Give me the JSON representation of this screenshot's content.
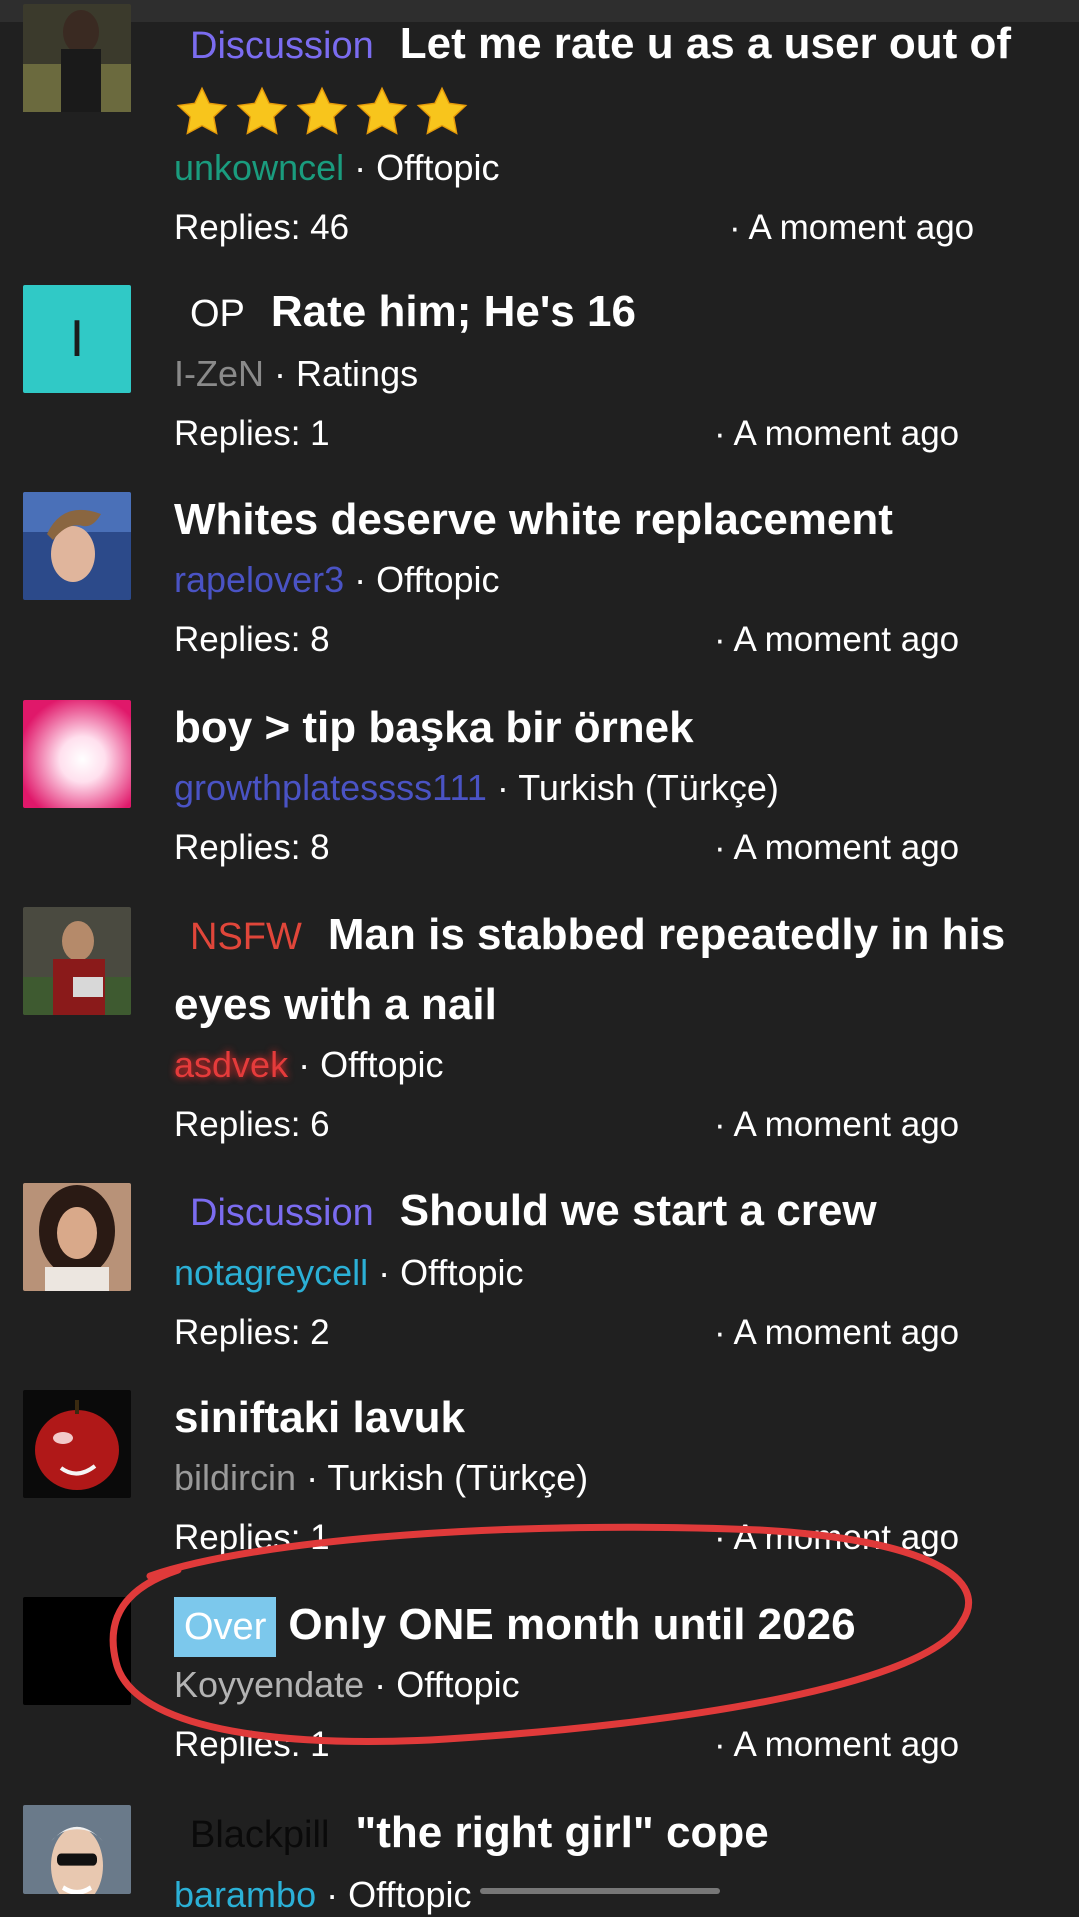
{
  "threads": [
    {
      "tag": "Discussion",
      "title": "Let me rate u as a user out of",
      "rating_stars": 5,
      "author": "unkowncel",
      "category": "Offtopic",
      "replies": "Replies: 46",
      "time": "· A moment ago"
    },
    {
      "avatar_letter": "I",
      "tag": "OP",
      "title": "Rate him; He's 16",
      "author": "I-ZeN",
      "category": "Ratings",
      "replies": "Replies: 1",
      "time": "· A moment ago"
    },
    {
      "title": "Whites deserve white replacement",
      "author": "rapelover3",
      "category": "Offtopic",
      "replies": "Replies: 8",
      "time": "· A moment ago"
    },
    {
      "title": "boy > tip başka bir örnek",
      "author": "growthplatessss111",
      "category": "Turkish (Türkçe)",
      "replies": "Replies: 8",
      "time": "· A moment ago"
    },
    {
      "tag": "NSFW",
      "title": "Man is stabbed repeatedly in his eyes with a nail",
      "author": "asdvek",
      "category": "Offtopic",
      "replies": "Replies: 6",
      "time": "· A moment ago"
    },
    {
      "tag": "Discussion",
      "title": "Should we start a crew",
      "author": "notagreycell",
      "category": "Offtopic",
      "replies": "Replies: 2",
      "time": "· A moment ago"
    },
    {
      "title": "siniftaki lavuk",
      "author": "bildircin",
      "category": "Turkish (Türkçe)",
      "replies": "Replies: 1",
      "time": "· A moment ago"
    },
    {
      "tag": "Over",
      "title": "Only ONE month until 2026",
      "author": "Koyyendate",
      "category": "Offtopic",
      "replies": "Replies: 1",
      "time": "· A moment ago"
    },
    {
      "tag": "Blackpill",
      "title": "\"the right girl\" cope",
      "author": "barambo",
      "category": "Offtopic"
    }
  ],
  "separator": "·",
  "colors": {
    "background": "#202020",
    "discussion_tag": "#7b6cf0",
    "nsfw_tag": "#e0463a",
    "over_tag_bg": "#7cc8ec",
    "annotation_circle": "#e03a3a"
  }
}
